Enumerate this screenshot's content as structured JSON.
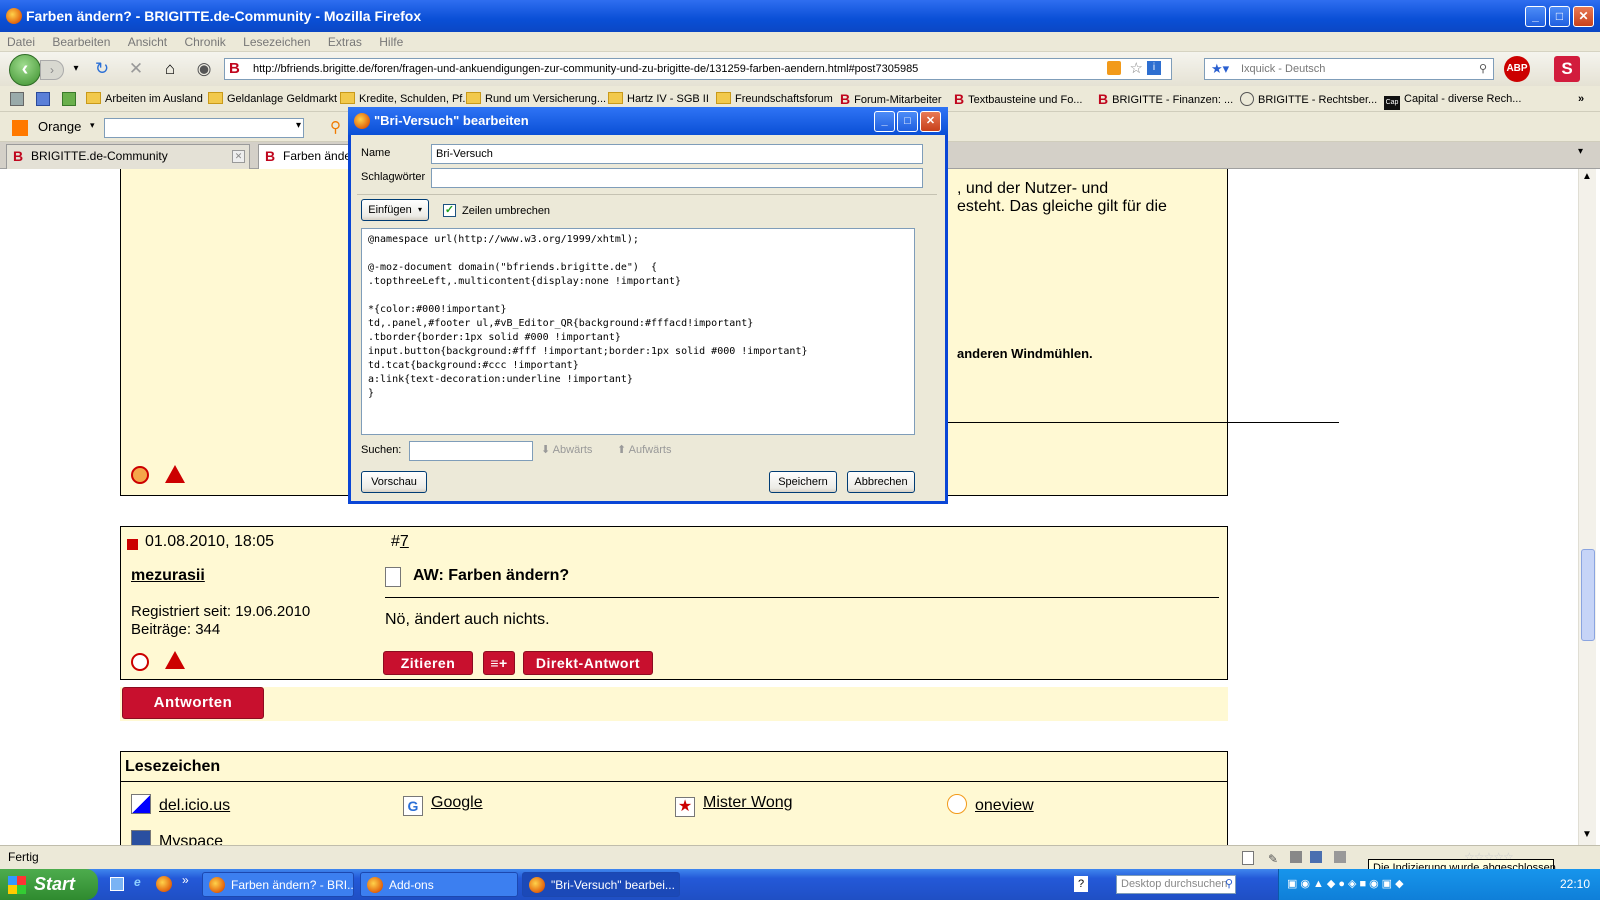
{
  "window": {
    "title": "Farben ändern? - BRIGITTE.de-Community - Mozilla Firefox"
  },
  "menu": [
    "Datei",
    "Bearbeiten",
    "Ansicht",
    "Chronik",
    "Lesezeichen",
    "Extras",
    "Hilfe"
  ],
  "nav": {
    "url": "http://bfriends.brigitte.de/foren/fragen-und-ankuendigungen-zur-community-und-zu-brigitte-de/131259-farben-aendern.html#post7305985",
    "search_placeholder": "Ixquick - Deutsch"
  },
  "bookmarks": [
    "Arbeiten im Ausland",
    "Geldanlage Geldmarkt",
    "Kredite, Schulden, Pf...",
    "Rund um Versicherung...",
    "Hartz IV - SGB II",
    "Freundschaftsforum",
    "Forum-Mitarbeiter",
    "Textbausteine und Fo...",
    "BRIGITTE - Finanzen: ...",
    "BRIGITTE - Rechtsber...",
    "Capital - diverse Rech..."
  ],
  "orange_toolbar": {
    "name": "Orange"
  },
  "tabs": [
    {
      "label": "BRIGITTE.de-Community"
    },
    {
      "label": "Farben ändern? - BRIGITTE.de-Community"
    }
  ],
  "page": {
    "prev_post_text": [
      ", und der Nutzer- und",
      "esteht. Das gleiche gilt für die"
    ],
    "prev_post_bold": "anderen Windmühlen.",
    "post7": {
      "date": "01.08.2010, 18:05",
      "number_prefix": "#",
      "number": "7",
      "user": "mezurasii",
      "registered": "Registriert seit: 19.06.2010",
      "posts": "Beiträge: 344",
      "subject": "AW: Farben ändern?",
      "body": "Nö, ändert auch nichts.",
      "quote_label": "Zitieren",
      "direct_reply_label": "Direkt-Antwort"
    },
    "reply_label": "Antworten",
    "bookmarks_heading": "Lesezeichen",
    "social": [
      "del.icio.us",
      "Google",
      "Mister Wong",
      "oneview",
      "Myspace"
    ]
  },
  "dialog": {
    "title": "\"Bri-Versuch\" bearbeiten",
    "name_label": "Name",
    "name_value": "Bri-Versuch",
    "keywords_label": "Schlagwörter",
    "keywords_value": "",
    "insert_label": "Einfügen",
    "wrap_label": "Zeilen umbrechen",
    "wrap_checked": true,
    "code": "@namespace url(http://www.w3.org/1999/xhtml);\n\n@-moz-document domain(\"bfriends.brigitte.de\")  {\n.topthreeLeft,.multicontent{display:none !important}\n\n*{color:#000!important}\ntd,.panel,#footer ul,#vB_Editor_QR{background:#fffacd!important}\n.tborder{border:1px solid #000 !important}\ninput.button{background:#fff !important;border:1px solid #000 !important}\ntd.tcat{background:#ccc !important}\na:link{text-decoration:underline !important}\n}",
    "search_label": "Suchen:",
    "search_value": "",
    "down_label": "Abwärts",
    "up_label": "Aufwärts",
    "preview_label": "Vorschau",
    "save_label": "Speichern",
    "cancel_label": "Abbrechen"
  },
  "status": {
    "text": "Fertig",
    "tooltip": "Die Indizierung wurde abgeschlossen."
  },
  "taskbar": {
    "start_label": "Start",
    "tasks": [
      "Farben ändern? - BRI...",
      "Add-ons",
      "\"Bri-Versuch\" bearbei..."
    ],
    "desktop_search_placeholder": "Desktop durchsuchen",
    "clock": "22:10"
  },
  "colors": {
    "post_bg": "#fff9d3",
    "brand_red": "#c8102e",
    "xp_blue": "#0a4fd6"
  }
}
